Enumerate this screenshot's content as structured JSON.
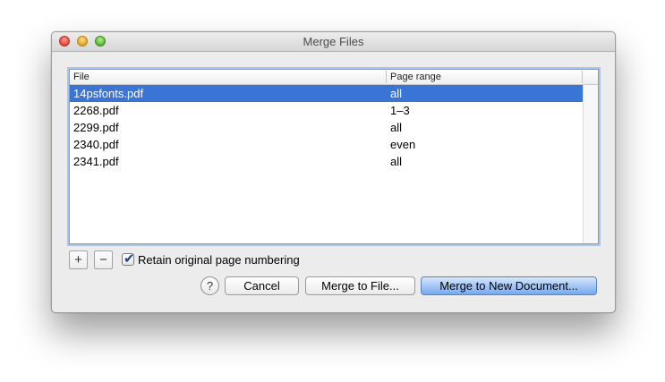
{
  "window": {
    "title": "Merge Files"
  },
  "table": {
    "columns": {
      "file": "File",
      "page_range": "Page range"
    },
    "rows": [
      {
        "file": "14psfonts.pdf",
        "range": "all",
        "selected": true
      },
      {
        "file": "2268.pdf",
        "range": "1–3",
        "selected": false
      },
      {
        "file": "2299.pdf",
        "range": "all",
        "selected": false
      },
      {
        "file": "2340.pdf",
        "range": "even",
        "selected": false
      },
      {
        "file": "2341.pdf",
        "range": "all",
        "selected": false
      }
    ]
  },
  "controls": {
    "add_label": "+",
    "remove_label": "−",
    "retain_checkbox": {
      "label": "Retain original page numbering",
      "checked": true,
      "mark": "✔"
    }
  },
  "buttons": {
    "help_label": "?",
    "cancel_label": "Cancel",
    "merge_file_label": "Merge to File...",
    "merge_new_label": "Merge to New Document..."
  },
  "colors": {
    "selection": "#3a75d6",
    "default_button": "#77a9ef",
    "close": "#e0443a",
    "minimize": "#dea11e",
    "zoom": "#53b531"
  },
  "icons": {
    "close": "close-traffic-light",
    "minimize": "minimize-traffic-light",
    "zoom": "zoom-traffic-light"
  }
}
